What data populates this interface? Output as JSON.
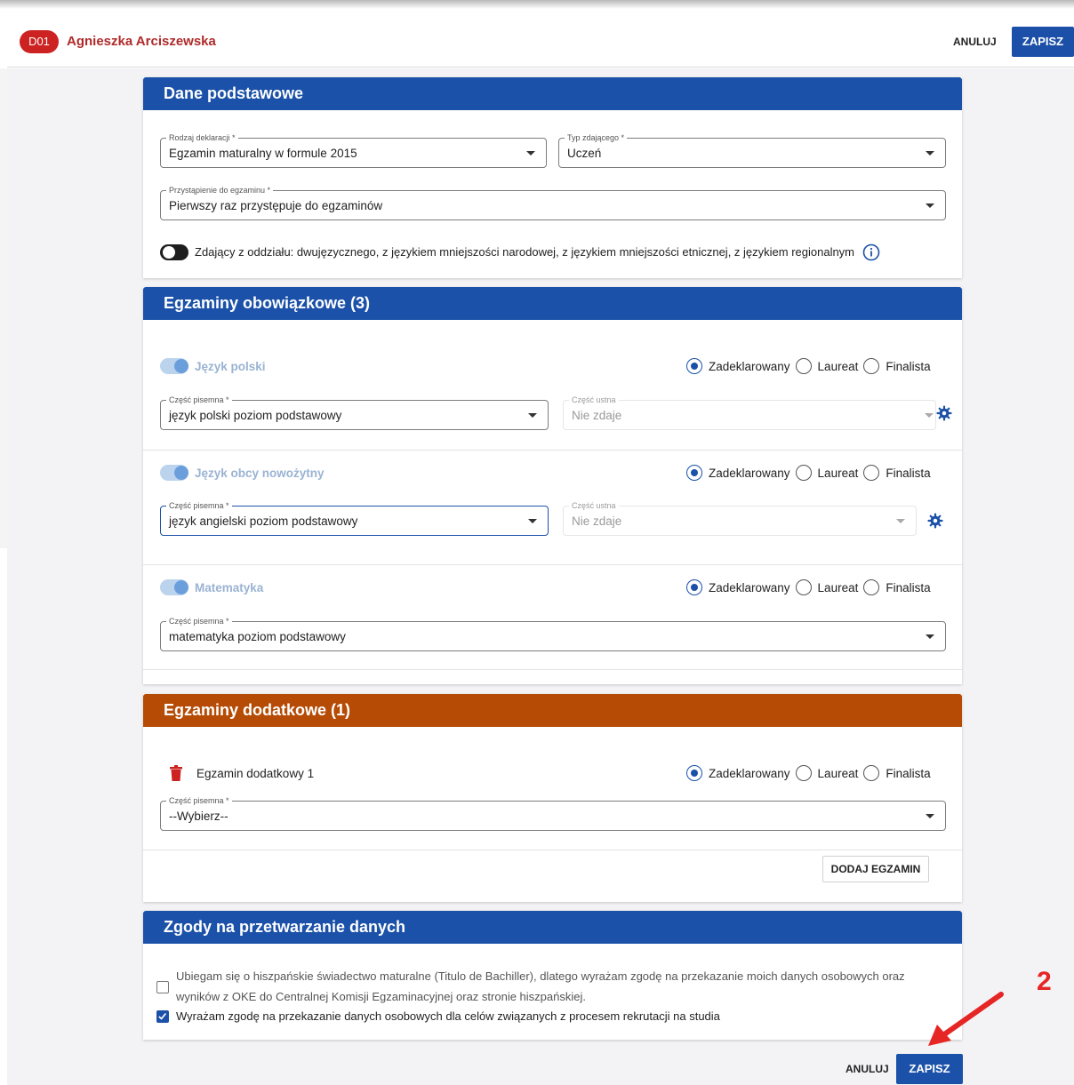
{
  "header": {
    "badge": "D01",
    "student_name": "Agnieszka Arciszewska",
    "cancel_label": "ANULUJ",
    "save_label": "ZAPISZ"
  },
  "basic": {
    "title": "Dane podstawowe",
    "declaration_type": {
      "label": "Rodzaj deklaracji *",
      "value": "Egzamin maturalny w formule 2015"
    },
    "examinee_type": {
      "label": "Typ zdającego *",
      "value": "Uczeń"
    },
    "exam_attempt": {
      "label": "Przystąpienie do egzaminu *",
      "value": "Pierwszy raz przystępuje do egzaminów"
    },
    "bilingual_toggle_label": "Zdający z oddziału: dwujęzycznego, z językiem mniejszości narodowej, z językiem mniejszości etnicznej, z językiem regionalnym"
  },
  "mandatory": {
    "title": "Egzaminy obowiązkowe (3)",
    "radio_labels": {
      "declared": "Zadeklarowany",
      "laureate": "Laureat",
      "finalist": "Finalista"
    },
    "subjects": [
      {
        "name": "Język polski",
        "written": {
          "label": "Część pisemna *",
          "value": "język polski poziom podstawowy"
        },
        "oral": {
          "label": "Część ustna",
          "value": "Nie zdaje"
        }
      },
      {
        "name": "Język obcy nowożytny",
        "written": {
          "label": "Część pisemna *",
          "value": "język angielski poziom podstawowy"
        },
        "oral": {
          "label": "Część ustna",
          "value": "Nie zdaje"
        }
      },
      {
        "name": "Matematyka",
        "written": {
          "label": "Część pisemna *",
          "value": "matematyka poziom podstawowy"
        }
      }
    ]
  },
  "additional": {
    "title": "Egzaminy dodatkowe (1)",
    "exam_name": "Egzamin dodatkowy 1",
    "written": {
      "label": "Część pisemna *",
      "value": "--Wybierz--"
    },
    "add_button": "DODAJ EGZAMIN"
  },
  "consents": {
    "title": "Zgody na przetwarzanie danych",
    "spanish_line1": "Ubiegam się o hiszpańskie świadectwo maturalne (Titulo de Bachiller), dlatego wyrażam zgodę na przekazanie moich danych osobowych oraz",
    "spanish_line2": "wyników z OKE do Centralnej Komisji Egzaminacyjnej oraz stronie hiszpańskiej.",
    "spanish_checked": false,
    "recruitment": "Wyrażam zgodę na przekazanie danych osobowych dla celów związanych z procesem rekrutacji na studia",
    "recruitment_checked": true
  },
  "footer": {
    "cancel_label": "ANULUJ",
    "save_label": "ZAPISZ"
  },
  "annotation": {
    "number": "2"
  },
  "colors": {
    "primary": "#1b51a8",
    "orange_header": "#b54b05",
    "badge_red": "#cc2222",
    "annotation_red": "#e62525"
  }
}
